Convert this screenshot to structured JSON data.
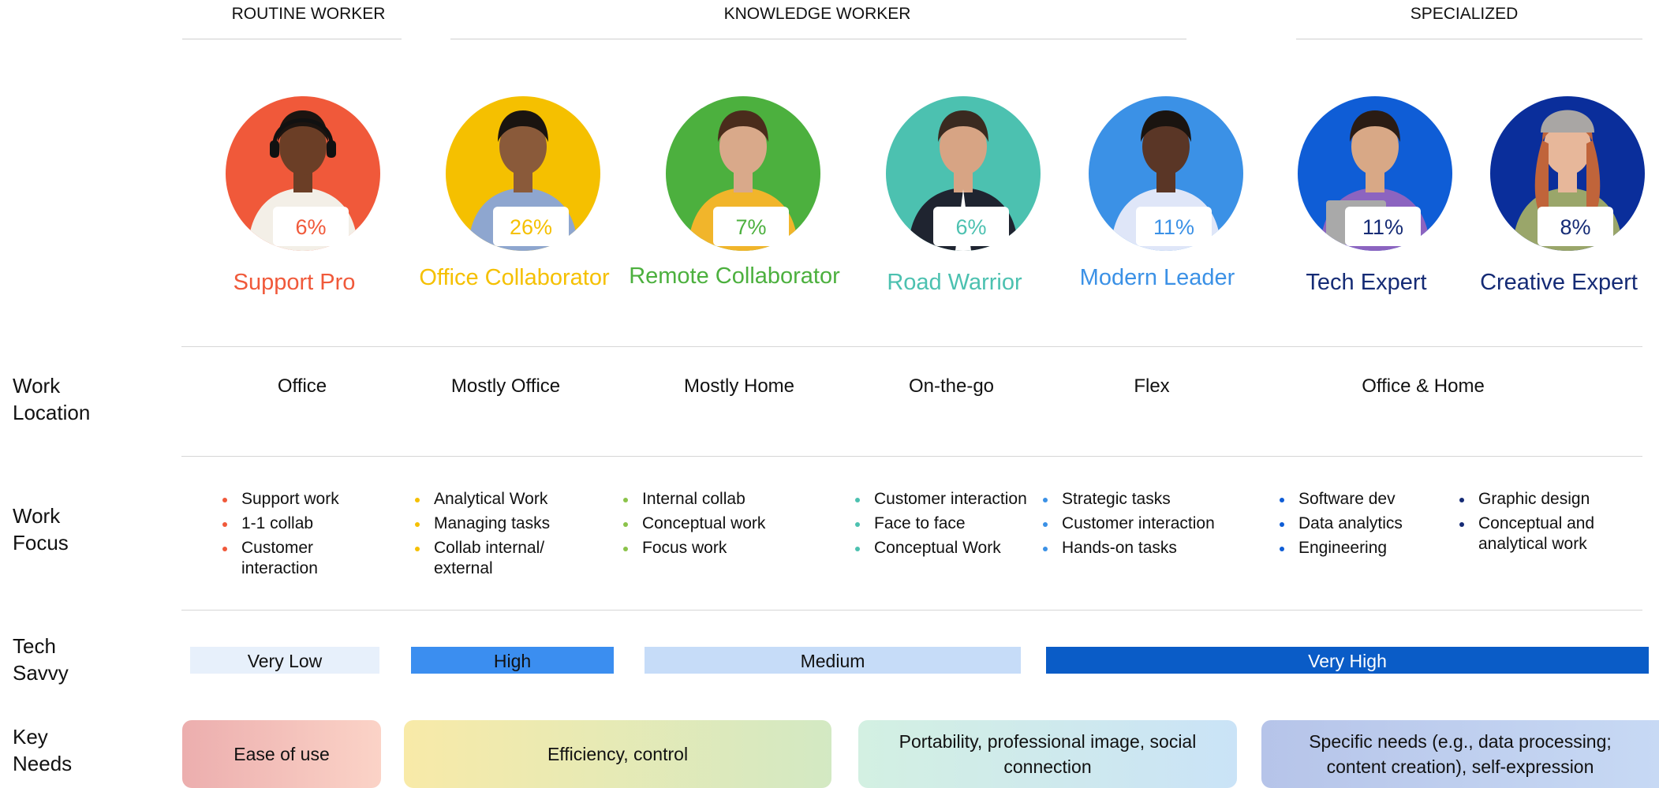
{
  "categories": {
    "routine": "ROUTINE WORKER",
    "knowledge": "KNOWLEDGE WORKER",
    "specialized": "SPECIALIZED"
  },
  "row_labels": {
    "location": [
      "Work",
      "Location"
    ],
    "focus": [
      "Work",
      "Focus"
    ],
    "tech": [
      "Tech",
      "Savvy"
    ],
    "needs": [
      "Key",
      "Needs"
    ]
  },
  "personas": [
    {
      "name": "Support Pro",
      "pct": "6%",
      "color": "#f0593a",
      "bg": "#f0593a",
      "shirt": "#f3efe7",
      "skin": "#6b3e26",
      "hair": "#1c1410",
      "icon": "headset-woman"
    },
    {
      "name": "Office Collaborator",
      "pct": "26%",
      "color": "#f5c000",
      "bg": "#f5c000",
      "shirt": "#8ea6cf",
      "skin": "#8a5a3a",
      "hair": "#1a1410",
      "icon": "man-crossed-arms"
    },
    {
      "name": "Remote Collaborator",
      "pct": "7%",
      "color": "#4cb03e",
      "bg": "#4cb03e",
      "shirt": "#f1b52b",
      "skin": "#d9a98a",
      "hair": "#4a2c1c",
      "icon": "woman-yellow-sweater"
    },
    {
      "name": "Road Warrior",
      "pct": "6%",
      "color": "#4cc1b0",
      "bg": "#4cc1b0",
      "shirt": "#1f2430",
      "skin": "#d7a484",
      "hair": "#3a2a20",
      "icon": "man-suit-phone"
    },
    {
      "name": "Modern Leader",
      "pct": "11%",
      "color": "#3b91e6",
      "bg": "#3b91e6",
      "shirt": "#dfe6f8",
      "skin": "#5a3626",
      "hair": "#1a1410",
      "icon": "man-smiling"
    },
    {
      "name": "Tech Expert",
      "pct": "11%",
      "color": "#152b75",
      "bg": "#0f5dd6",
      "shirt": "#8c64c0",
      "skin": "#d8a886",
      "hair": "#2a1c14",
      "icon": "man-laptop"
    },
    {
      "name": "Creative Expert",
      "pct": "8%",
      "color": "#152b75",
      "bg": "#0a2e9b",
      "shirt": "#9aa66a",
      "skin": "#e7b79a",
      "hair": "#c0643a",
      "icon": "woman-beanie"
    }
  ],
  "locations": [
    "Office",
    "Mostly Office",
    "Mostly Home",
    "On-the-go",
    "Flex",
    "Office & Home"
  ],
  "focus": [
    {
      "color": "#f0593a",
      "items": [
        "Support work",
        "1-1 collab",
        "Customer interaction"
      ]
    },
    {
      "color": "#f5c000",
      "items": [
        "Analytical Work",
        "Managing tasks",
        "Collab internal/ external"
      ]
    },
    {
      "color": "#8bc34a",
      "items": [
        "Internal  collab",
        "Conceptual work",
        "Focus work"
      ]
    },
    {
      "color": "#4cc1b0",
      "items": [
        "Customer interaction",
        "Face to face",
        "Conceptual Work"
      ]
    },
    {
      "color": "#3b91e6",
      "items": [
        "Strategic tasks",
        "Customer interaction",
        "Hands-on tasks"
      ]
    },
    {
      "color": "#0f5dd6",
      "items": [
        "Software dev",
        "Data analytics",
        "Engineering"
      ]
    },
    {
      "color": "#152b75",
      "items": [
        "Graphic design",
        "Conceptual and analytical work"
      ]
    }
  ],
  "tech": [
    {
      "label": "Very Low",
      "bg": "#e7f0fb",
      "fg": "#111111"
    },
    {
      "label": "High",
      "bg": "#3b8ef0",
      "fg": "#111111"
    },
    {
      "label": "Medium",
      "bg": "#c6dcf8",
      "fg": "#111111"
    },
    {
      "label": "Very High",
      "bg": "#0a5cc7",
      "fg": "#ffffff"
    }
  ],
  "needs": [
    {
      "label": "Ease of use",
      "gradient": [
        "#ecaeae",
        "#fbd3c7"
      ]
    },
    {
      "label": "Efficiency, control",
      "gradient": [
        "#f8eaa8",
        "#d3e9c3"
      ]
    },
    {
      "label": "Portability, professional image, social connection",
      "gradient": [
        "#d3f0e2",
        "#cae3f7"
      ]
    },
    {
      "label": "Specific needs (e.g., data processing; content creation), self-expression",
      "gradient": [
        "#b6c4e9",
        "#c7d9f4"
      ]
    }
  ]
}
